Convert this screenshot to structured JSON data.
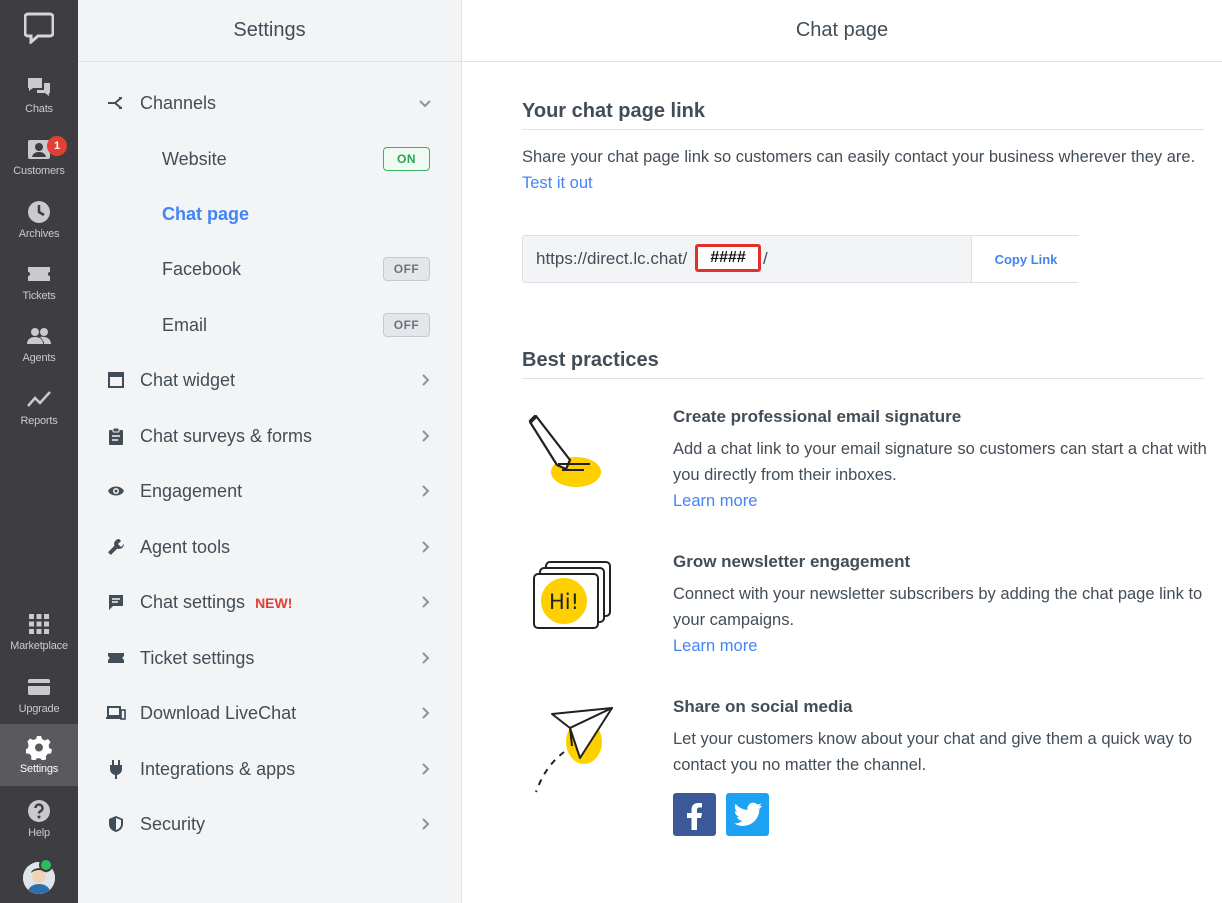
{
  "rail": {
    "items": [
      {
        "label": "Chats",
        "icon": "chats-icon"
      },
      {
        "label": "Customers",
        "icon": "customers-icon",
        "badge": "1"
      },
      {
        "label": "Archives",
        "icon": "archives-icon"
      },
      {
        "label": "Tickets",
        "icon": "tickets-icon"
      },
      {
        "label": "Agents",
        "icon": "agents-icon"
      },
      {
        "label": "Reports",
        "icon": "reports-icon"
      },
      {
        "label": "Marketplace",
        "icon": "marketplace-icon"
      },
      {
        "label": "Upgrade",
        "icon": "upgrade-icon"
      },
      {
        "label": "Settings",
        "icon": "settings-icon",
        "active": true
      },
      {
        "label": "Help",
        "icon": "help-icon"
      }
    ]
  },
  "sidebar": {
    "title": "Settings",
    "channels": {
      "label": "Channels",
      "expanded": true
    },
    "sub_items": [
      {
        "label": "Website",
        "toggle": "ON"
      },
      {
        "label": "Chat page",
        "active": true
      },
      {
        "label": "Facebook",
        "toggle": "OFF"
      },
      {
        "label": "Email",
        "toggle": "OFF"
      }
    ],
    "items": [
      {
        "label": "Chat widget",
        "icon": "window-icon"
      },
      {
        "label": "Chat surveys & forms",
        "icon": "clipboard-icon"
      },
      {
        "label": "Engagement",
        "icon": "eye-icon"
      },
      {
        "label": "Agent tools",
        "icon": "wrench-icon"
      },
      {
        "label": "Chat settings",
        "icon": "chat-bubble-icon",
        "tag": "NEW!"
      },
      {
        "label": "Ticket settings",
        "icon": "ticket-icon"
      },
      {
        "label": "Download LiveChat",
        "icon": "devices-icon"
      },
      {
        "label": "Integrations & apps",
        "icon": "plug-icon"
      },
      {
        "label": "Security",
        "icon": "shield-icon"
      }
    ]
  },
  "main": {
    "title": "Chat page",
    "link_section": {
      "title": "Your chat page link",
      "description": "Share your chat page link so customers can easily contact your business wherever they are.",
      "test_link": "Test it out",
      "url_prefix": "https://direct.lc.chat/",
      "url_redacted": "####",
      "url_suffix": "/",
      "copy_button": "Copy Link"
    },
    "best_practices": {
      "title": "Best practices",
      "items": [
        {
          "title": "Create professional email signature",
          "text": "Add a chat link to your email signature so customers can start a chat with you directly from their inboxes.",
          "link": "Learn more",
          "illustration": "pencil-signature-icon"
        },
        {
          "title": "Grow newsletter engagement",
          "text": "Connect with your newsletter subscribers by adding the chat page link to your campaigns.",
          "link": "Learn more",
          "illustration": "hi-letters-icon",
          "illustration_text": "Hi!"
        },
        {
          "title": "Share on social media",
          "text": "Let your customers know about your chat and give them a quick way to contact you no matter the channel.",
          "illustration": "paper-plane-icon",
          "social": [
            "facebook-icon",
            "twitter-icon"
          ]
        }
      ]
    }
  },
  "colors": {
    "rail_bg": "#3e3d42",
    "accent": "#4384f5",
    "on_green": "#34b563",
    "new_red": "#e23f35",
    "illustration_yellow": "#ffd000",
    "facebook": "#3b5998",
    "twitter": "#1da1f2"
  }
}
